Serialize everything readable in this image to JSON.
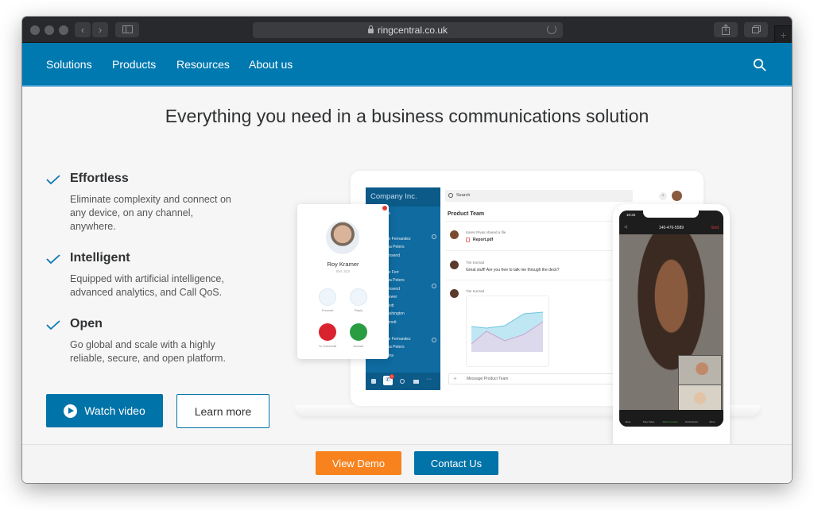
{
  "browser": {
    "url": "ringcentral.co.uk",
    "back_label": "‹",
    "forward_label": "›",
    "new_tab_label": "+"
  },
  "nav": {
    "items": [
      "Solutions",
      "Products",
      "Resources",
      "About us"
    ],
    "brand_color": "#0079b1"
  },
  "hero": {
    "title": "Everything you need in a business communications solution",
    "features": [
      {
        "title": "Effortless",
        "description": "Eliminate complexity and connect on any device, on any channel, anywhere."
      },
      {
        "title": "Intelligent",
        "description": "Equipped with artificial intelligence, advanced analytics, and Call QoS."
      },
      {
        "title": "Open",
        "description": "Go global and scale with a highly reliable, secure, and open platform."
      }
    ],
    "watch_video_label": "Watch video",
    "learn_more_label": "Learn more"
  },
  "illustration": {
    "app": {
      "company": "Company Inc.",
      "search_placeholder": "Search",
      "channel": "Product Team",
      "sidebar_items": [
        "Bookmarks",
        "Favorites",
        "Direct",
        "Jaqueline Fernandez",
        "Samantha Peters",
        "Rob Townsend",
        "Teams",
        "Jaqueline Ferr",
        "Samantha Peters",
        "Rob Townsend",
        "Kevin Brewer",
        "Peter Elliott",
        "Ellen Washington",
        "Mark Barnett",
        "Groups",
        "Jaqueline Fernandez",
        "Samantha Peters",
        "Kevin Sims"
      ],
      "phone_badge": "1",
      "messages": [
        {
          "author": "Karen Rivas",
          "action": "shared a file",
          "file": "Report.pdf"
        },
        {
          "author": "Tim Konrad",
          "text": "Great stuff! Are you free to talk me through the deck?"
        },
        {
          "author": "Tim Konrad",
          "text": ""
        }
      ],
      "compose_placeholder": "Message Product Team"
    },
    "call_card": {
      "name": "Roy Kramer",
      "ext": "Ext. 213",
      "actions": [
        "Forward",
        "Reply",
        "To Voicemail",
        "Answer"
      ]
    },
    "phone": {
      "time": "10:34",
      "number": "140-476-5589",
      "end_label": "End",
      "toolbar": [
        "Mute",
        "Stop Video",
        "Share Content",
        "Participants",
        "More"
      ]
    }
  },
  "footer": {
    "view_demo_label": "View Demo",
    "contact_us_label": "Contact Us",
    "demo_color": "#f7821e"
  }
}
